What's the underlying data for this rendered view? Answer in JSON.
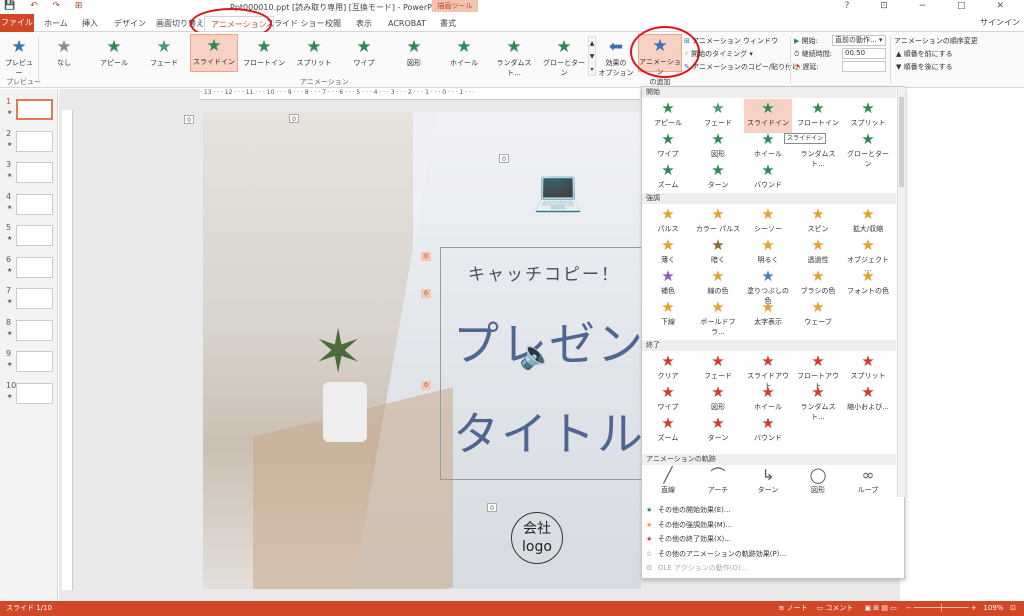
{
  "titlebar": {
    "title": "Ppt000010.ppt [読み取り専用] [互換モード] - PowerPoint",
    "contextual_tab": "描画ツール",
    "window_buttons": "? ⊡ − □ ✕"
  },
  "tabs": {
    "file": "ファイル",
    "home": "ホーム",
    "insert": "挿入",
    "design": "デザイン",
    "transitions": "画面切り替え",
    "animations": "アニメーション",
    "slideshow": "スライド ショー",
    "review": "校閲",
    "view": "表示",
    "acrobat": "ACROBAT",
    "format": "書式",
    "signin": "サインイン"
  },
  "ribbon": {
    "preview_label": "プレビュー",
    "preview_group": "プレビュー",
    "animation_group": "アニメーション",
    "effects": [
      {
        "label": "なし",
        "color": "#8c8c8c"
      },
      {
        "label": "アピール",
        "color": "#2e8b57"
      },
      {
        "label": "フェード",
        "color": "#4a9a82"
      },
      {
        "label": "スライドイン",
        "color": "#2e8b57"
      },
      {
        "label": "フロートイン",
        "color": "#2e8b57"
      },
      {
        "label": "スプリット",
        "color": "#2e8b57"
      },
      {
        "label": "ワイプ",
        "color": "#2e8b57"
      },
      {
        "label": "図形",
        "color": "#2e8b57"
      },
      {
        "label": "ホイール",
        "color": "#2e8b57"
      },
      {
        "label": "ランダムスト...",
        "color": "#2e8b57"
      },
      {
        "label": "グローとターン",
        "color": "#2e8b57"
      }
    ],
    "effect_options_line1": "効果の",
    "effect_options_line2": "オプション",
    "add_animation_line1": "アニメーション",
    "add_animation_line2": "の追加",
    "animation_pane": "アニメーション ウィンドウ",
    "trigger": "開始のタイミング",
    "copy_animation": "アニメーションのコピー/貼り付け",
    "start_label": "開始:",
    "start_value": "直前の動作...",
    "duration_label": "継続時間:",
    "duration_value": "00.50",
    "delay_label": "遅延:",
    "reorder_title": "アニメーションの順序変更",
    "move_earlier": "順番を前にする",
    "move_later": "順番を後にする"
  },
  "thumbnails": [
    {
      "num": "1"
    },
    {
      "num": "2"
    },
    {
      "num": "3"
    },
    {
      "num": "4"
    },
    {
      "num": "5"
    },
    {
      "num": "6"
    },
    {
      "num": "7"
    },
    {
      "num": "8"
    },
    {
      "num": "9"
    },
    {
      "num": "10"
    }
  ],
  "ruler": {
    "h_ticks": "· 13 · · · 12 · · · 11 · · · 10 · · · 9 · · · 8 · · · 7 · · · 6 · · · 5 · · · 4 · · · 3 · · · 2 · · · 1 · · · 0 · · · 1 · · ·"
  },
  "slide": {
    "catch_copy": "キャッチコピー！",
    "title_line1": "プレゼン",
    "title_line2": "タイトル",
    "logo_line1": "会社",
    "logo_line2": "logo",
    "tags": [
      "0",
      "0",
      "0",
      "0",
      "0",
      "0",
      "0"
    ]
  },
  "gallery": {
    "entrance_title": "開始",
    "entrance": [
      {
        "label": "アピール",
        "color": "#2e8b57"
      },
      {
        "label": "フェード",
        "color": "#4a9a82"
      },
      {
        "label": "スライドイン",
        "color": "#2e8b57"
      },
      {
        "label": "フロートイン",
        "color": "#2e8b57"
      },
      {
        "label": "スプリット",
        "color": "#2e8b57"
      },
      {
        "label": "ワイプ",
        "color": "#2e8b57"
      },
      {
        "label": "図形",
        "color": "#2e8b57"
      },
      {
        "label": "ホイール",
        "color": "#2e8b57"
      },
      {
        "label": "ランダムスト...",
        "color": "#2e8b57"
      },
      {
        "label": "グローとターン",
        "color": "#2e8b57"
      },
      {
        "label": "ズーム",
        "color": "#2e8b57"
      },
      {
        "label": "ターン",
        "color": "#2e8b57"
      },
      {
        "label": "バウンド",
        "color": "#2e8b57"
      }
    ],
    "emphasis_title": "強調",
    "emphasis": [
      {
        "label": "パルス",
        "color": "#e6a02c"
      },
      {
        "label": "カラー パルス",
        "color": "#e6a02c"
      },
      {
        "label": "シーソー",
        "color": "#e6a02c"
      },
      {
        "label": "スピン",
        "color": "#e6a02c"
      },
      {
        "label": "拡大/収縮",
        "color": "#e6a02c"
      },
      {
        "label": "薄く",
        "color": "#e6a02c"
      },
      {
        "label": "暗く",
        "color": "#8a6a2c"
      },
      {
        "label": "明るく",
        "color": "#e6a02c"
      },
      {
        "label": "透過性",
        "color": "#e6a02c"
      },
      {
        "label": "オブジェクト ...",
        "color": "#e6a02c"
      },
      {
        "label": "補色",
        "color": "#8a5ac8"
      },
      {
        "label": "線の色",
        "color": "#e6a02c"
      },
      {
        "label": "塗りつぶしの色",
        "color": "#4a7ac8"
      },
      {
        "label": "ブラシの色",
        "color": "#e6a02c"
      },
      {
        "label": "フォントの色",
        "color": "#e6a02c"
      },
      {
        "label": "下線",
        "color": "#e6a02c"
      },
      {
        "label": "ボールドフラ...",
        "color": "#e6a02c"
      },
      {
        "label": "太字表示",
        "color": "#e6a02c"
      },
      {
        "label": "ウェーブ",
        "color": "#e6a02c"
      }
    ],
    "exit_title": "終了",
    "exit": [
      {
        "label": "クリア",
        "color": "#d33c2c"
      },
      {
        "label": "フェード",
        "color": "#d33c2c"
      },
      {
        "label": "スライドアウト",
        "color": "#d33c2c"
      },
      {
        "label": "フロートアウト",
        "color": "#d33c2c"
      },
      {
        "label": "スプリット",
        "color": "#d33c2c"
      },
      {
        "label": "ワイプ",
        "color": "#d33c2c"
      },
      {
        "label": "図形",
        "color": "#d33c2c"
      },
      {
        "label": "ホイール",
        "color": "#d33c2c"
      },
      {
        "label": "ランダムスト...",
        "color": "#d33c2c"
      },
      {
        "label": "縮小および...",
        "color": "#d33c2c"
      },
      {
        "label": "ズーム",
        "color": "#d33c2c"
      },
      {
        "label": "ターン",
        "color": "#d33c2c"
      },
      {
        "label": "バウンド",
        "color": "#d33c2c"
      }
    ],
    "path_title": "アニメーションの軌跡",
    "paths": [
      {
        "label": "直線"
      },
      {
        "label": "アーチ"
      },
      {
        "label": "ターン"
      },
      {
        "label": "図形"
      },
      {
        "label": "ループ"
      }
    ],
    "links": [
      {
        "label": "その他の開始効果(E)...",
        "color": "#2e8b57"
      },
      {
        "label": "その他の強調効果(M)...",
        "color": "#e6a02c"
      },
      {
        "label": "その他の終了効果(X)...",
        "color": "#d33c2c"
      },
      {
        "label": "その他のアニメーションの軌跡効果(P)...",
        "color": "#555555"
      },
      {
        "label": "OLE アクションの動作(O)...",
        "color": "#aaaaaa"
      }
    ],
    "tooltip": "スライドイン"
  },
  "statusbar": {
    "slide": "スライド 1/10",
    "notes": "ノート",
    "comments": "コメント",
    "zoom": "109%"
  },
  "colors": {
    "accent": "#d24726",
    "highlight": "#f7d2c4",
    "annotation_circle": "#e0141e"
  }
}
